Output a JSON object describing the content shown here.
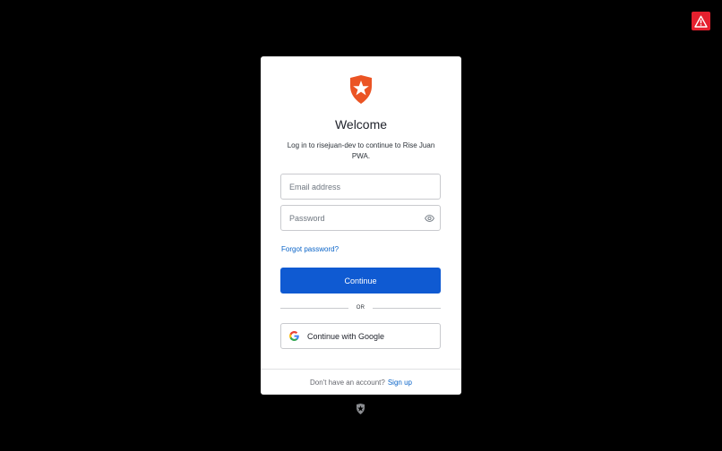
{
  "header": {
    "title": "Welcome",
    "subtitle": "Log in to risejuan-dev to continue to Rise Juan PWA."
  },
  "form": {
    "email_placeholder": "Email address",
    "password_placeholder": "Password",
    "forgot_password_label": "Forgot password?",
    "continue_label": "Continue",
    "divider_label": "OR",
    "google_label": "Continue with Google"
  },
  "footer": {
    "prompt": "Don't have an account?",
    "signup_label": "Sign up"
  },
  "icons": {
    "brand_logo": "auth0-shield-icon",
    "password_toggle": "eye-icon",
    "google": "google-icon",
    "warning": "warning-icon",
    "footer_logo": "auth0-badge-icon"
  },
  "colors": {
    "background": "#000000",
    "card": "#ffffff",
    "brand": "#eb5424",
    "primary_button": "#0f5ad2",
    "link": "#0a64c8",
    "warning": "#e5202e"
  }
}
